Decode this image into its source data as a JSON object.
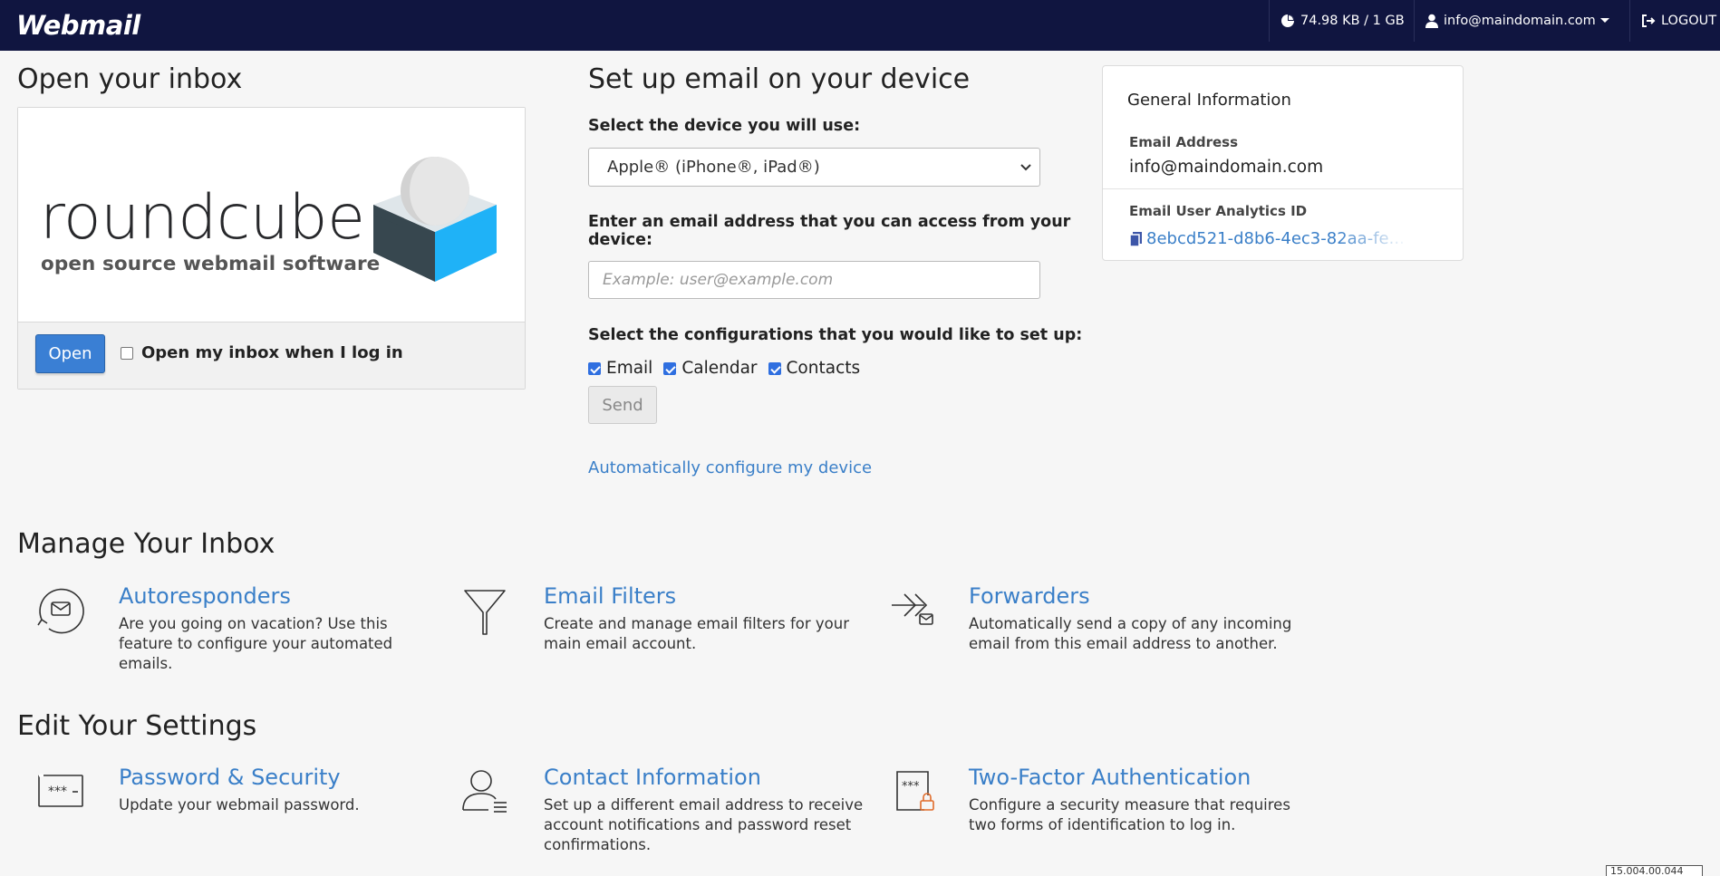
{
  "topbar": {
    "logo": "Webmail",
    "usage": "74.98 KB / 1 GB",
    "user": "info@maindomain.com",
    "logout": "LOGOUT"
  },
  "inbox": {
    "heading": "Open your inbox",
    "brand_word": "roundcube",
    "brand_tagline": "open source webmail software",
    "open_button": "Open",
    "auto_open_label": "Open my inbox when I log in",
    "auto_open_checked": false
  },
  "setup": {
    "heading": "Set up email on your device",
    "device_label": "Select the device you will use:",
    "device_selected": "Apple® (iPhone®, iPad®)",
    "email_label_line1": "Enter an email address that you can access from your",
    "email_label_line2": "device:",
    "email_placeholder": "Example: user@example.com",
    "config_label": "Select the configurations that you would like to set up:",
    "configs": [
      {
        "label": "Email",
        "checked": true
      },
      {
        "label": "Calendar",
        "checked": true
      },
      {
        "label": "Contacts",
        "checked": true
      }
    ],
    "send_button": "Send",
    "auto_config_link": "Automatically configure my device"
  },
  "general_info": {
    "title": "General Information",
    "email_label": "Email Address",
    "email_value": "info@maindomain.com",
    "analytics_label": "Email User Analytics ID",
    "analytics_value_visible": "8ebcd521-d8b6-4ec3-8",
    "analytics_value_faded": "2aa-fe..."
  },
  "manage": {
    "heading": "Manage Your Inbox",
    "items": [
      {
        "title": "Autoresponders",
        "desc": "Are you going on vacation? Use this feature to configure your automated emails.",
        "icon": "autoresponder-icon"
      },
      {
        "title": "Email Filters",
        "desc": "Create and manage email filters for your main email account.",
        "icon": "filter-icon"
      },
      {
        "title": "Forwarders",
        "desc": "Automatically send a copy of any incoming email from this email address to another.",
        "icon": "forwarder-icon"
      }
    ]
  },
  "settings": {
    "heading": "Edit Your Settings",
    "items": [
      {
        "title": "Password & Security",
        "desc": "Update your webmail password.",
        "icon": "password-icon"
      },
      {
        "title": "Contact Information",
        "desc": "Set up a different email address to receive account notifications and password reset confirmations.",
        "icon": "contact-icon"
      },
      {
        "title": "Two-Factor Authentication",
        "desc": "Configure a security measure that requires two forms of identification to log in.",
        "icon": "two-factor-icon"
      }
    ]
  },
  "corner_tag": "15.004.00.044",
  "colors": {
    "topbar": "#101540",
    "link": "#3a7fc8",
    "primary_button": "#3a7fd4",
    "roundcube_blue": "#1fb2f7"
  }
}
